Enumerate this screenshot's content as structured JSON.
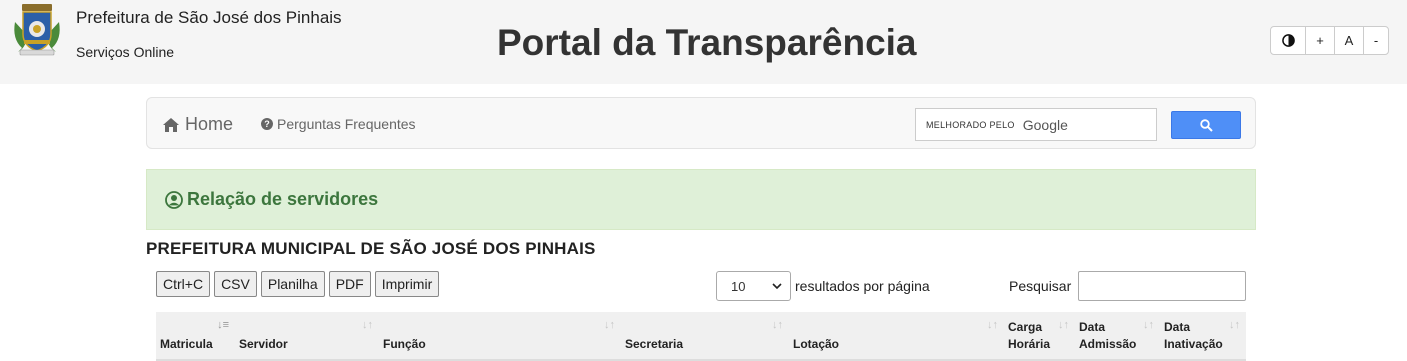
{
  "header": {
    "org_name": "Prefeitura de São José dos Pinhais",
    "services": "Serviços Online",
    "portal_title": "Portal da Transparência",
    "accessibility": {
      "increase": "+",
      "normal": "A",
      "decrease": "-"
    }
  },
  "nav": {
    "home": "Home",
    "faq": "Perguntas Frequentes",
    "google_prefix": "MELHORADO PELO",
    "google_word": "Google"
  },
  "section": {
    "title": "Relação de servidores"
  },
  "heading": "PREFEITURA MUNICIPAL DE SÃO JOSÉ DOS PINHAIS",
  "toolbar": {
    "export_buttons": [
      "Ctrl+C",
      "CSV",
      "Planilha",
      "PDF",
      "Imprimir"
    ],
    "per_page_value": "10",
    "per_page_label": "resultados por página",
    "search_label": "Pesquisar"
  },
  "table": {
    "columns": [
      "Matricula",
      "Servidor",
      "Função",
      "Secretaria",
      "Lotação",
      "Carga Horária",
      "Data Admissão",
      "Data Inativação"
    ]
  },
  "colors": {
    "accent_green": "#3c763d",
    "search_blue": "#4f8ff7"
  }
}
